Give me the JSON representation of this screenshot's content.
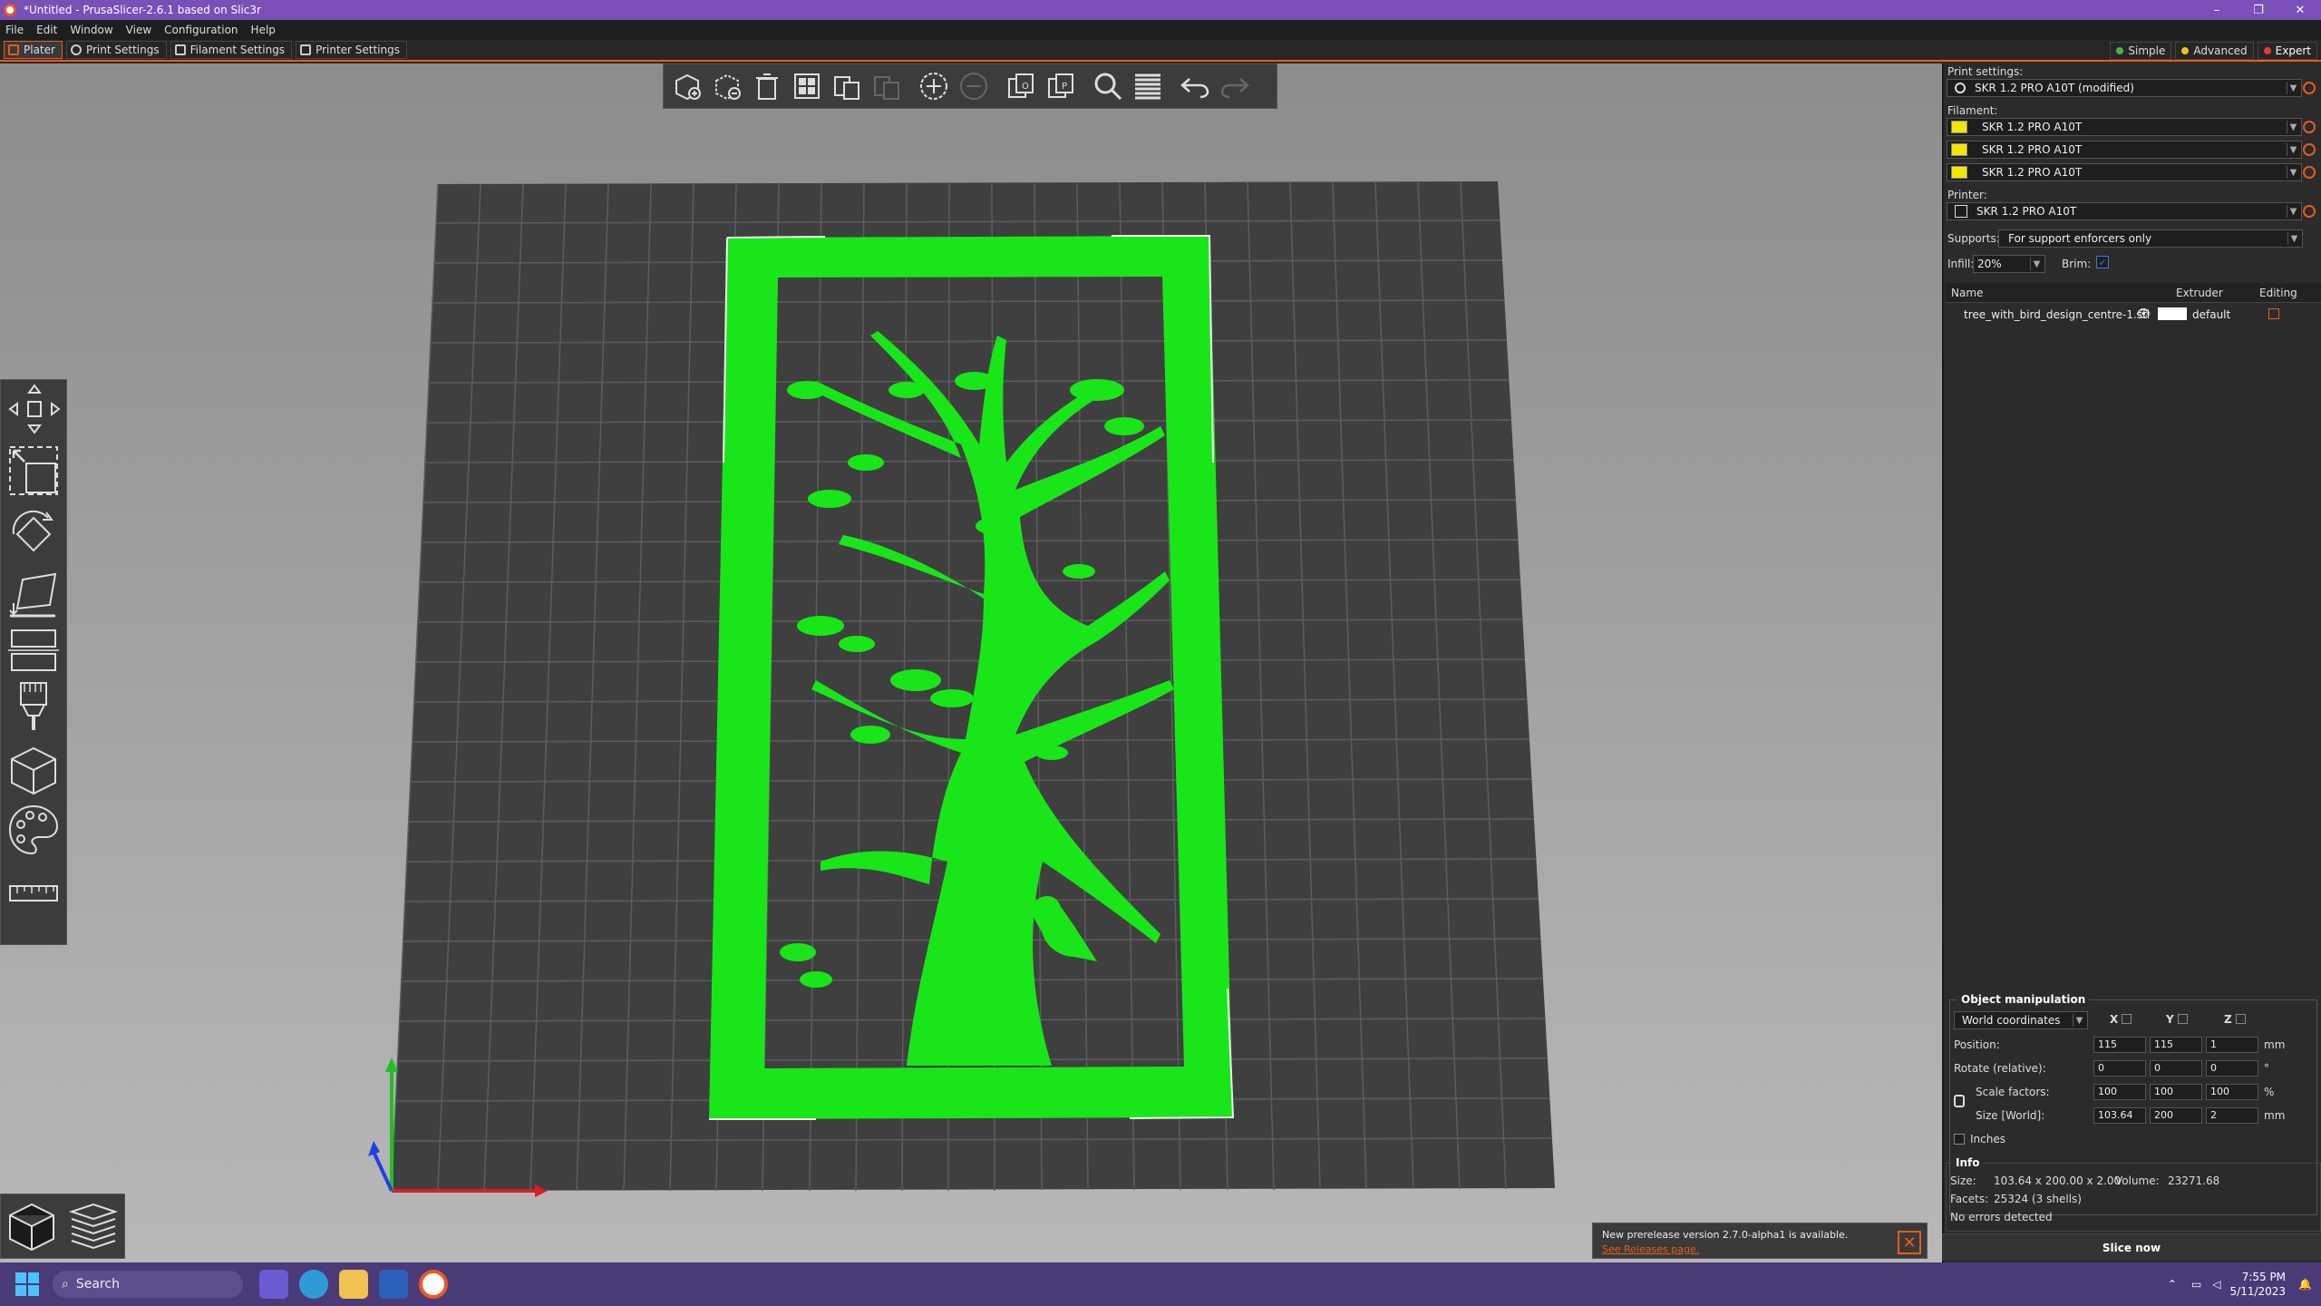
{
  "window": {
    "title": "*Untitled - PrusaSlicer-2.6.1 based on Slic3r",
    "controls": [
      "–",
      "❐",
      "✕"
    ]
  },
  "menu": [
    "File",
    "Edit",
    "Window",
    "View",
    "Configuration",
    "Help"
  ],
  "tabs": [
    "Plater",
    "Print Settings",
    "Filament Settings",
    "Printer Settings"
  ],
  "modes": [
    {
      "label": "Simple",
      "color": "#4caf50"
    },
    {
      "label": "Advanced",
      "color": "#f0c020"
    },
    {
      "label": "Expert",
      "color": "#e53935"
    }
  ],
  "colors": {
    "accent": "#e85b1e",
    "model": "#19e619",
    "bed": "#3f3f3f"
  },
  "sidebar": {
    "print_settings_label": "Print settings:",
    "print_profile": "SKR 1.2 PRO A10T (modified)",
    "filament_label": "Filament:",
    "filaments": [
      "SKR 1.2 PRO A10T",
      "SKR 1.2 PRO A10T",
      "SKR 1.2 PRO A10T"
    ],
    "printer_label": "Printer:",
    "printer_profile": "SKR 1.2 PRO A10T",
    "supports_label": "Supports:",
    "supports_value": "For support enforcers only",
    "infill_label": "Infill:",
    "infill_value": "20%",
    "brim_label": "Brim:",
    "table_headers": {
      "name": "Name",
      "extruder": "Extruder",
      "editing": "Editing"
    },
    "object": {
      "name": "tree_with_bird_design_centre-1.stl",
      "extruder": "default"
    }
  },
  "manipulation": {
    "title": "Object manipulation",
    "coord_system": "World coordinates",
    "axes": [
      "X",
      "Y",
      "Z"
    ],
    "position_label": "Position:",
    "position": [
      "115",
      "115",
      "1"
    ],
    "position_unit": "mm",
    "rotate_label": "Rotate (relative):",
    "rotate": [
      "0",
      "0",
      "0"
    ],
    "rotate_unit": "°",
    "scale_label": "Scale factors:",
    "scale": [
      "100",
      "100",
      "100"
    ],
    "scale_unit": "%",
    "size_label": "Size [World]:",
    "size": [
      "103.64",
      "200",
      "2"
    ],
    "size_unit": "mm",
    "inches_label": "Inches"
  },
  "info": {
    "title": "Info",
    "size_label": "Size:",
    "size_value": "103.64 x 200.00 x 2.00",
    "volume_label": "Volume:",
    "volume_value": "23271.68",
    "facets_label": "Facets:",
    "facets_value": "25324 (3 shells)",
    "errors": "No errors detected"
  },
  "slice_button": "Slice now",
  "notification": {
    "line1": "New prerelease version 2.7.0-alpha1 is available.",
    "link": "See Releases page."
  },
  "taskbar": {
    "search_placeholder": "Search",
    "time": "7:55 PM",
    "date": "5/11/2023"
  }
}
